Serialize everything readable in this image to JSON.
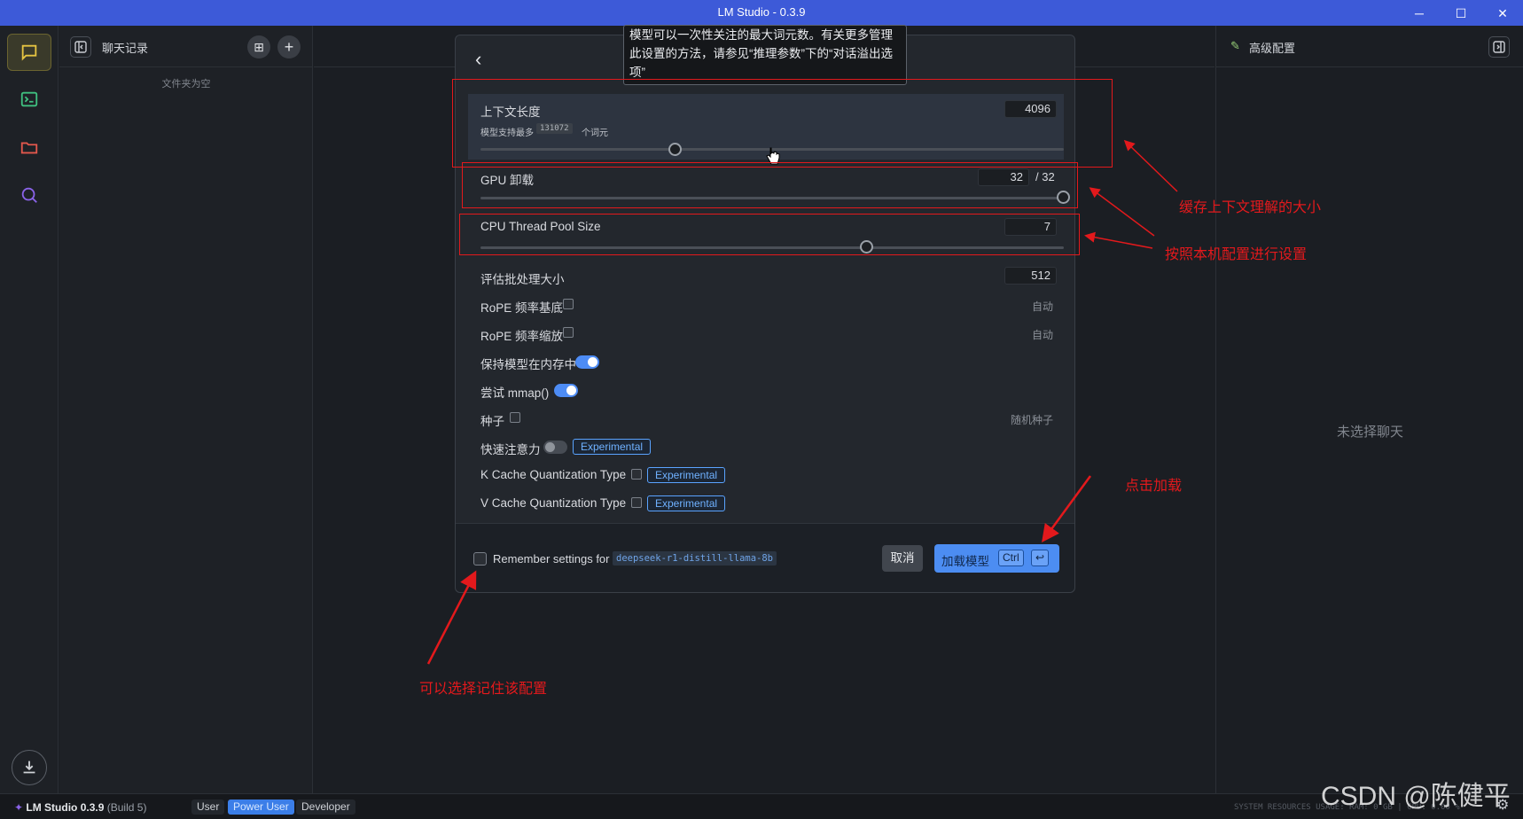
{
  "window": {
    "title": "LM Studio - 0.3.9",
    "min": "─",
    "max": "☐",
    "close": "✕"
  },
  "rail": {
    "items": [
      {
        "icon": "chat-icon",
        "active": true
      },
      {
        "icon": "terminal-icon",
        "active": false
      },
      {
        "icon": "folder-icon",
        "active": false
      },
      {
        "icon": "search-icon",
        "active": false
      }
    ],
    "download_icon": "download-icon"
  },
  "sidebar": {
    "title": "聊天记录",
    "empty": "文件夹为空",
    "new_folder": "⊞",
    "new_chat": "+"
  },
  "right_panel": {
    "title": "高级配置",
    "pencil": "✎",
    "none_selected": "未选择聊天"
  },
  "modal": {
    "back": "‹",
    "tooltip": "模型可以一次性关注的最大词元数。有关更多管理此设置的方法，请参见“推理参数”下的“对话溢出选项”",
    "context": {
      "label": "上下文长度",
      "value": "4096",
      "hint_prefix": "模型支持最多",
      "hint_max": "131072",
      "hint_suffix": "个词元",
      "fraction": 0.335
    },
    "gpu": {
      "label": "GPU 卸载",
      "value": "32",
      "max": "/ 32",
      "fraction": 1.0
    },
    "cpu": {
      "label": "CPU Thread Pool Size",
      "value": "7",
      "fraction": 0.663
    },
    "batch": {
      "label": "评估批处理大小",
      "value": "512"
    },
    "rope_base": {
      "label": "RoPE 频率基底",
      "value": "自动"
    },
    "rope_scale": {
      "label": "RoPE 频率缩放",
      "value": "自动"
    },
    "keep_in_memory": {
      "label": "保持模型在内存中"
    },
    "mmap": {
      "label": "尝试 mmap()"
    },
    "seed": {
      "label": "种子",
      "value": "随机种子"
    },
    "flash_attention": {
      "label": "快速注意力",
      "badge": "Experimental"
    },
    "k_cache": {
      "label": "K Cache Quantization Type",
      "badge": "Experimental"
    },
    "v_cache": {
      "label": "V Cache Quantization Type",
      "badge": "Experimental"
    },
    "footer": {
      "remember_label": "Remember settings for",
      "model_name": "deepseek-r1-distill-llama-8b",
      "cancel": "取消",
      "load": "加载模型",
      "kbd_ctrl": "Ctrl",
      "kbd_enter": "↩"
    }
  },
  "annotations": {
    "cache_size": "缓存上下文理解的大小",
    "per_machine": "按照本机配置进行设置",
    "click_load": "点击加载",
    "remember": "可以选择记住该配置"
  },
  "statusbar": {
    "app": "LM Studio 0.3.9",
    "build": "(Build 5)",
    "modes": [
      "User",
      "Power User",
      "Developer"
    ],
    "active_mode": "Power User",
    "sys_resources": "SYSTEM RESOURCES USAGE:  RAM: 0 GB  |  CPU: 0.00 %",
    "gear": "⚙"
  },
  "watermark": "CSDN @陈健平",
  "colors": {
    "accent": "#4c8df2",
    "titlebar": "#3d5ad8",
    "annotation": "#e3191c"
  }
}
